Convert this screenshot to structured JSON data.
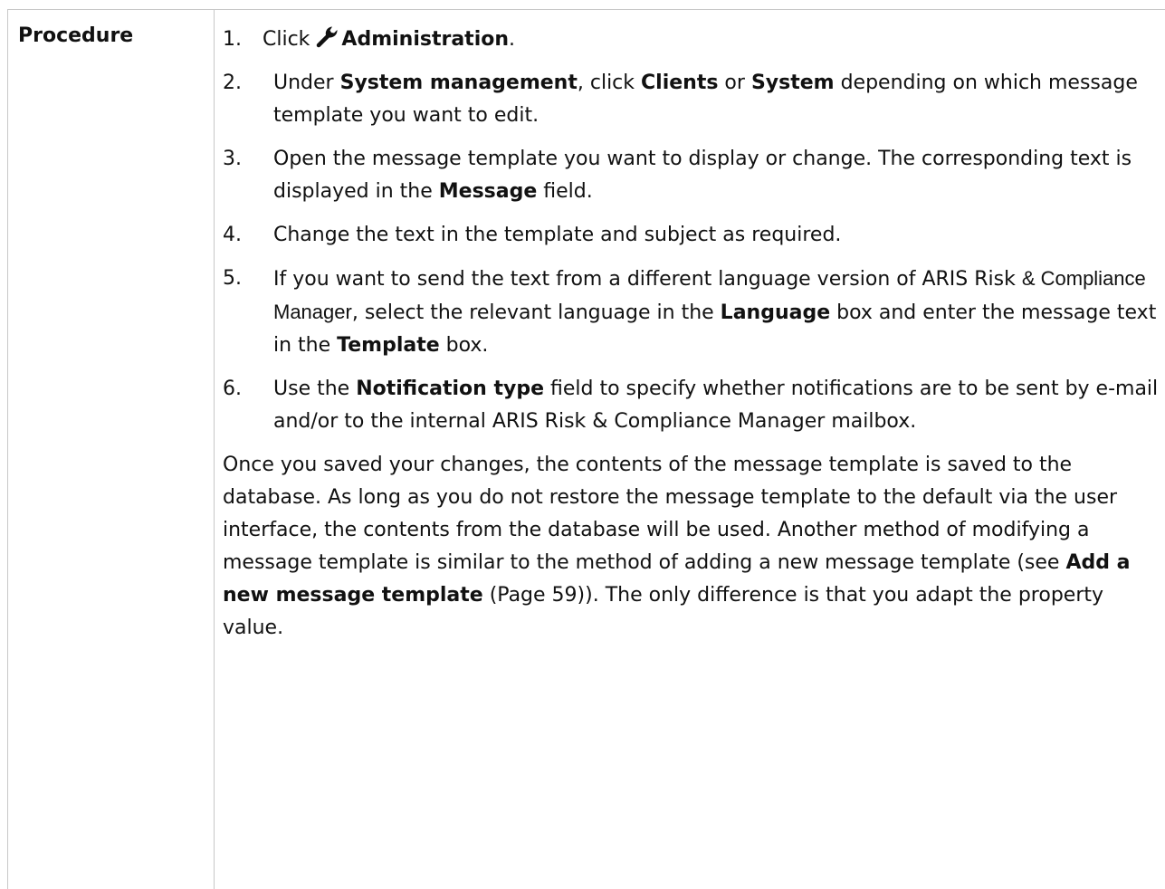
{
  "table": {
    "label": "Procedure"
  },
  "steps": [
    {
      "num": "1.",
      "segments": [
        {
          "t": "Click ",
          "b": false
        },
        {
          "icon": "wrench-icon"
        },
        {
          "t": "Administration",
          "b": true
        },
        {
          "t": ".",
          "b": false
        }
      ]
    },
    {
      "num": "2.",
      "segments": [
        {
          "t": "Under ",
          "b": false
        },
        {
          "t": "System management",
          "b": true
        },
        {
          "t": ", click ",
          "b": false
        },
        {
          "t": "Clients",
          "b": true
        },
        {
          "t": " or ",
          "b": false
        },
        {
          "t": "System",
          "b": true
        },
        {
          "t": " depending on which message template you want to edit.",
          "b": false
        }
      ]
    },
    {
      "num": "3.",
      "segments": [
        {
          "t": "Open the message template you want to display or change. The corresponding text is displayed in the ",
          "b": false
        },
        {
          "t": "Message",
          "b": true
        },
        {
          "t": " field.",
          "b": false
        }
      ]
    },
    {
      "num": "4.",
      "segments": [
        {
          "t": "Change the text in the template and subject as required.",
          "b": false
        }
      ]
    },
    {
      "num": "5.",
      "segments": [
        {
          "t": "If you want to send the text from a different language version of ARIS Risk ",
          "b": false
        },
        {
          "t": "& Compliance Manager",
          "b": false,
          "compact": true
        },
        {
          "t": ", select the relevant language in the ",
          "b": false
        },
        {
          "t": "Language",
          "b": true
        },
        {
          "t": " box and enter the message text in the ",
          "b": false
        },
        {
          "t": "Template",
          "b": true
        },
        {
          "t": " box.",
          "b": false
        }
      ]
    },
    {
      "num": "6.",
      "segments": [
        {
          "t": "Use the ",
          "b": false
        },
        {
          "t": "Notification type",
          "b": true
        },
        {
          "t": " field to specify whether notifications are to be sent by e-mail and/or to the internal ARIS Risk & Compliance Manager mailbox.",
          "b": false
        }
      ]
    }
  ],
  "paragraph": [
    {
      "t": "Once you saved your changes, the contents of the message template is saved to the database. As long as you do not restore the message template to the default via the user interface, the contents from the database will be used. Another method of modifying a message template is similar to the method of adding a new message template (see ",
      "b": false
    },
    {
      "t": "Add a new message template",
      "b": true
    },
    {
      "t": " (Page 59)). The only difference is that you adapt the property value.",
      "b": false
    }
  ],
  "colors": {
    "text": "#111111",
    "rule": "#c8c8c8"
  }
}
